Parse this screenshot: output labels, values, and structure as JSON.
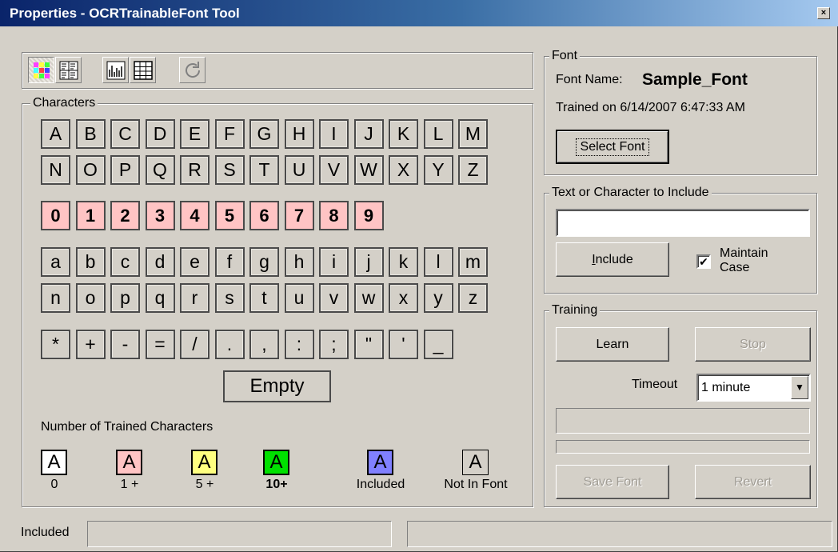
{
  "window": {
    "title": "Properties - OCRTrainableFont Tool",
    "close_glyph": "×"
  },
  "toolbar": {
    "buttons": [
      {
        "icon": "color-grid-icon",
        "pressed": true
      },
      {
        "icon": "character-grid-icon",
        "pressed": false
      },
      {
        "icon": "bar-chart-icon",
        "pressed": false
      },
      {
        "icon": "table-icon",
        "pressed": false
      },
      {
        "icon": "refresh-icon",
        "pressed": false
      }
    ]
  },
  "characters": {
    "label": "Characters",
    "upper": [
      [
        "A",
        "B",
        "C",
        "D",
        "E",
        "F",
        "G",
        "H",
        "I",
        "J",
        "K",
        "L",
        "M"
      ],
      [
        "N",
        "O",
        "P",
        "Q",
        "R",
        "S",
        "T",
        "U",
        "V",
        "W",
        "X",
        "Y",
        "Z"
      ]
    ],
    "digits": [
      "0",
      "1",
      "2",
      "3",
      "4",
      "5",
      "6",
      "7",
      "8",
      "9"
    ],
    "lower": [
      [
        "a",
        "b",
        "c",
        "d",
        "e",
        "f",
        "g",
        "h",
        "i",
        "j",
        "k",
        "l",
        "m"
      ],
      [
        "n",
        "o",
        "p",
        "q",
        "r",
        "s",
        "t",
        "u",
        "v",
        "w",
        "x",
        "y",
        "z"
      ]
    ],
    "symbols": [
      "*",
      "+",
      "-",
      "=",
      "/",
      ".",
      ",",
      ":",
      ";",
      "\"",
      "'",
      "_"
    ],
    "empty_label": "Empty"
  },
  "legend": {
    "title": "Number of Trained Characters",
    "items": [
      {
        "glyph": "A",
        "caption": "0",
        "color": "#ffffff",
        "bold": false
      },
      {
        "glyph": "A",
        "caption": "1 +",
        "color": "#ffc4c4",
        "bold": false
      },
      {
        "glyph": "A",
        "caption": "5 +",
        "color": "#ffff80",
        "bold": false
      },
      {
        "glyph": "A",
        "caption": "10+",
        "color": "#00e000",
        "bold": true
      },
      {
        "glyph": "A",
        "caption": "Included",
        "color": "#8080ff",
        "bold": false
      },
      {
        "glyph": "A",
        "caption": "Not In Font",
        "color": "#d4d0c8",
        "bold": false
      }
    ]
  },
  "font_group": {
    "label": "Font",
    "name_label": "Font Name:",
    "name_value": "Sample_Font",
    "trained_text": "Trained on 6/14/2007 6:47:33 AM",
    "select_button": "Select Font"
  },
  "include_group": {
    "label": "Text or Character to Include",
    "input_value": "",
    "include_button": "Include",
    "include_mnemonic": "I",
    "include_rest": "nclude",
    "maintain_case_label_1": "Maintain",
    "maintain_case_label_2": "Case",
    "maintain_case_checked": true,
    "check_glyph": "✔"
  },
  "training_group": {
    "label": "Training",
    "learn_button": "Learn",
    "stop_button": "Stop",
    "timeout_label": "Timeout",
    "timeout_value": "1 minute",
    "dropdown_glyph": "▼",
    "save_button": "Save Font",
    "revert_button": "Revert"
  },
  "status_bar": {
    "label": "Included",
    "value_1": "",
    "value_2": ""
  }
}
